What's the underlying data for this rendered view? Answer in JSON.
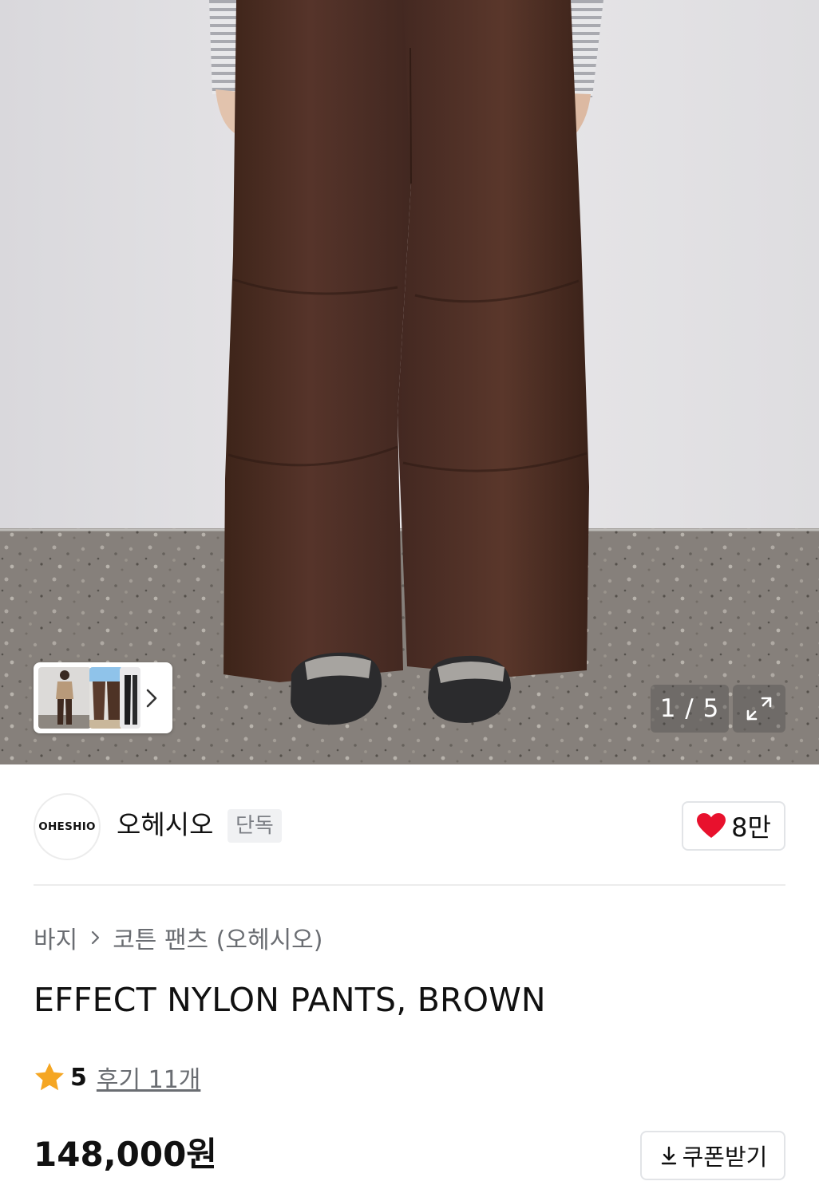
{
  "gallery": {
    "counter_text": "1 / 5",
    "current": 1,
    "total": 5,
    "icons": {
      "next": "chevron-right-icon",
      "expand": "expand-icon"
    }
  },
  "brand": {
    "logo_text": "OHESHIO",
    "name": "오헤시오",
    "badge": "단독",
    "likes": "8만",
    "like_icon": "heart-icon",
    "like_color": "#e8112d"
  },
  "breadcrumb": {
    "category": "바지",
    "subcategory": "코튼 팬츠 (오헤시오)"
  },
  "product": {
    "title": "EFFECT NYLON PANTS, BROWN",
    "rating": "5",
    "reviews_label": "후기 11개",
    "price": "148,000원",
    "star_color": "#f5a623"
  },
  "coupon": {
    "label": "쿠폰받기",
    "icon": "download-icon"
  }
}
